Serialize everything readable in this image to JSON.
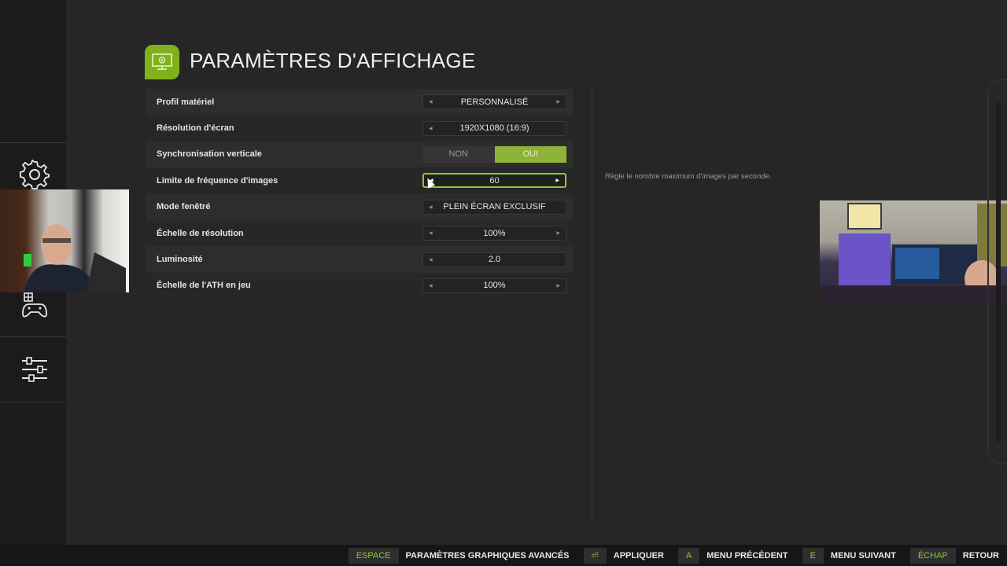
{
  "header": {
    "title": "PARAMÈTRES D'AFFICHAGE"
  },
  "settings": [
    {
      "label": "Profil matériel",
      "value": "PERSONNALISÉ",
      "type": "selector"
    },
    {
      "label": "Résolution d'écran",
      "value": "1920X1080 (16:9)",
      "type": "selector"
    },
    {
      "label": "Synchronisation verticale",
      "type": "toggle",
      "off": "NON",
      "on": "OUI",
      "selected": "OUI"
    },
    {
      "label": "Limite de fréquence d'images",
      "value": "60",
      "type": "selector",
      "active": true
    },
    {
      "label": "Mode fenêtré",
      "value": "PLEIN ÉCRAN EXCLUSIF",
      "type": "selector"
    },
    {
      "label": "Échelle de résolution",
      "value": "100%",
      "type": "selector"
    },
    {
      "label": "Luminosité",
      "value": "2.0",
      "type": "selector"
    },
    {
      "label": "Échelle de l'ATH en jeu",
      "value": "100%",
      "type": "selector"
    }
  ],
  "description": "Règle le nombre maximum d'images par seconde.",
  "bottom": {
    "hints": [
      {
        "key": "ESPACE",
        "label": "PARAMÈTRES GRAPHIQUES AVANCÉS"
      },
      {
        "key": "⏎",
        "label": "APPLIQUER"
      },
      {
        "key": "A",
        "label": "MENU PRÉCÉDENT"
      },
      {
        "key": "E",
        "label": "MENU SUIVANT"
      },
      {
        "key": "ÉCHAP",
        "label": "RETOUR"
      }
    ]
  },
  "colors": {
    "accent": "#8cc63f",
    "toggle_on": "#8fb339",
    "background": "#262626"
  },
  "icons": {
    "title": "monitor-gear-icon",
    "sidebar": [
      "gear-icon",
      "gamepad-icon",
      "sliders-icon"
    ]
  }
}
